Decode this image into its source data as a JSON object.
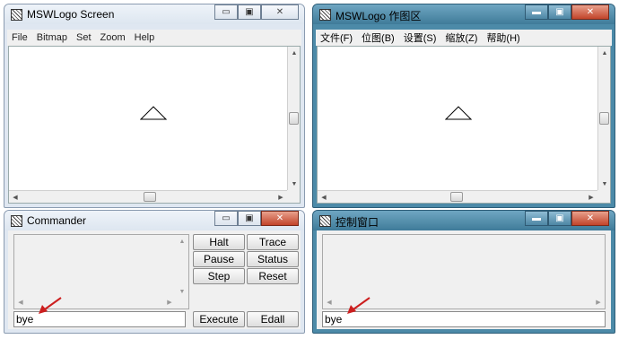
{
  "left_screen": {
    "title": "MSWLogo Screen",
    "menu": [
      "File",
      "Bitmap",
      "Set",
      "Zoom",
      "Help"
    ],
    "caption_min": "▭",
    "caption_max": "▣",
    "caption_close": "✕"
  },
  "right_screen": {
    "title": "MSWLogo 作图区",
    "menu": [
      "文件(F)",
      "位图(B)",
      "设置(S)",
      "缩放(Z)",
      "帮助(H)"
    ],
    "caption_min": "▬",
    "caption_max": "▣",
    "caption_close": "✕"
  },
  "left_commander": {
    "title": "Commander",
    "buttons": {
      "halt": "Halt",
      "trace": "Trace",
      "pause": "Pause",
      "status": "Status",
      "step": "Step",
      "reset": "Reset",
      "execute": "Execute",
      "edall": "Edall"
    },
    "input_value": "bye",
    "caption_min": "▭",
    "caption_max": "▣",
    "caption_close": "✕"
  },
  "right_commander": {
    "title": "控制窗口",
    "input_value": "bye",
    "caption_min": "▬",
    "caption_max": "▣",
    "caption_close": "✕"
  },
  "icons": {
    "app": "mswlogo-app-icon",
    "turtle": "turtle-triangle-icon",
    "pointer": "red-arrow-icon"
  },
  "colors": {
    "annotation_arrow": "#cc1f1f",
    "aero_frame": "#4c8aa8",
    "classic_frame": "#dfe7f1",
    "close_button": "#c2442a"
  }
}
